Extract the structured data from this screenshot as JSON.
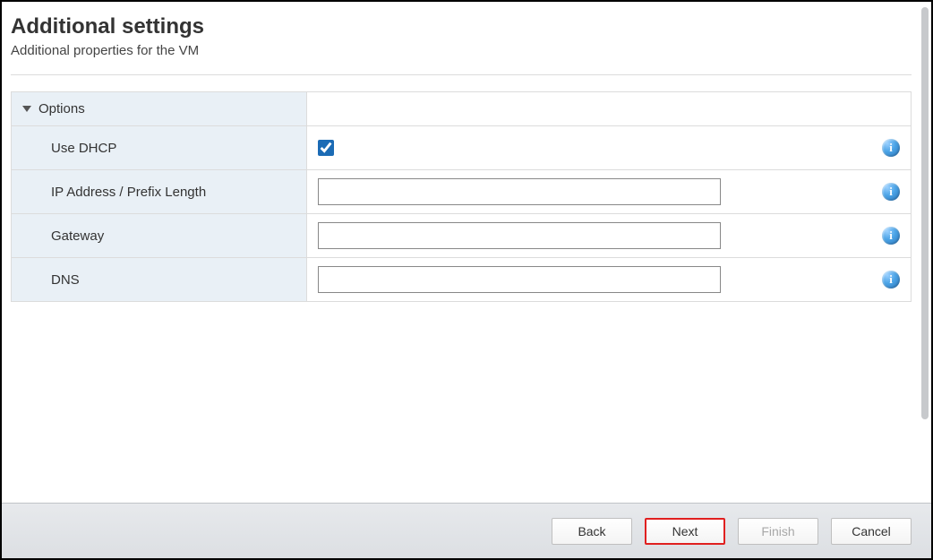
{
  "header": {
    "title": "Additional settings",
    "subtitle": "Additional properties for the VM"
  },
  "section": {
    "title": "Options"
  },
  "fields": {
    "dhcp": {
      "label": "Use DHCP",
      "checked": true
    },
    "ip": {
      "label": "IP Address / Prefix Length",
      "value": ""
    },
    "gw": {
      "label": "Gateway",
      "value": ""
    },
    "dns": {
      "label": "DNS",
      "value": ""
    }
  },
  "buttons": {
    "back": "Back",
    "next": "Next",
    "finish": "Finish",
    "cancel": "Cancel"
  }
}
